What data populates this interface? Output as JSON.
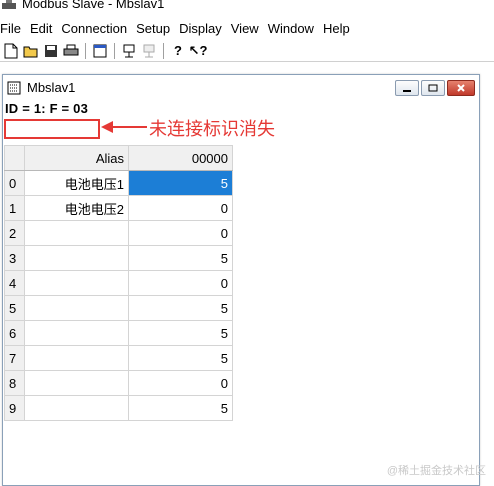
{
  "app": {
    "title": "Modbus Slave - Mbslav1"
  },
  "menu": [
    "File",
    "Edit",
    "Connection",
    "Setup",
    "Display",
    "View",
    "Window",
    "Help"
  ],
  "toolbar": {
    "buttons": [
      "new-icon",
      "open-icon",
      "save-icon",
      "print-icon",
      "window-icon",
      "connect-icon",
      "disconnect-icon",
      "help-icon",
      "context-help-icon"
    ]
  },
  "child_window": {
    "title": "Mbslav1",
    "status": "ID = 1: F = 03",
    "annotation": "未连接标识消失"
  },
  "grid": {
    "headers": {
      "alias": "Alias",
      "value": "00000"
    },
    "rows": [
      {
        "index": "0",
        "alias": "电池电压1",
        "value": "5"
      },
      {
        "index": "1",
        "alias": "电池电压2",
        "value": "0"
      },
      {
        "index": "2",
        "alias": "",
        "value": "0"
      },
      {
        "index": "3",
        "alias": "",
        "value": "5"
      },
      {
        "index": "4",
        "alias": "",
        "value": "0"
      },
      {
        "index": "5",
        "alias": "",
        "value": "5"
      },
      {
        "index": "6",
        "alias": "",
        "value": "5"
      },
      {
        "index": "7",
        "alias": "",
        "value": "5"
      },
      {
        "index": "8",
        "alias": "",
        "value": "0"
      },
      {
        "index": "9",
        "alias": "",
        "value": "5"
      }
    ]
  },
  "watermark": "@稀土掘金技术社区",
  "colors": {
    "selection": "#1c7ed6",
    "annotation": "#e53935"
  }
}
